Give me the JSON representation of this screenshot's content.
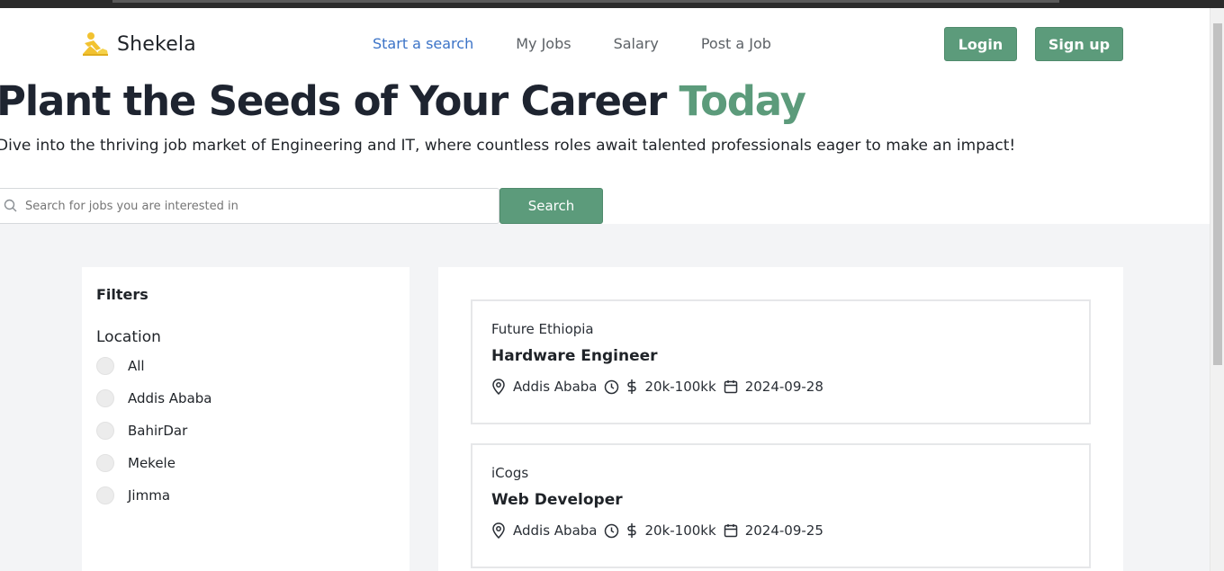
{
  "brand": {
    "name": "Shekela",
    "accent_color": "#5c9b7b",
    "link_color": "#3b73c7"
  },
  "nav": {
    "links": [
      {
        "label": "Start a search",
        "active": true
      },
      {
        "label": "My Jobs",
        "active": false
      },
      {
        "label": "Salary",
        "active": false
      },
      {
        "label": "Post a Job",
        "active": false
      }
    ],
    "login_label": "Login",
    "signup_label": "Sign up"
  },
  "hero": {
    "title_main": "Plant the Seeds of Your Career ",
    "title_accent": "Today",
    "subtitle": "Dive into the thriving job market of Engineering and IT, where countless roles await talented professionals eager to make an impact!"
  },
  "search": {
    "placeholder": "Search for jobs you are interested in",
    "button_label": "Search"
  },
  "filters": {
    "title": "Filters",
    "location_title": "Location",
    "locations": [
      "All",
      "Addis Ababa",
      "BahirDar",
      "Mekele",
      "Jimma"
    ]
  },
  "jobs": [
    {
      "company": "Future Ethiopia",
      "title": "Hardware Engineer",
      "location": "Addis Ababa",
      "salary": "20k-100kk",
      "date": "2024-09-28"
    },
    {
      "company": "iCogs",
      "title": "Web Developer",
      "location": "Addis Ababa",
      "salary": "20k-100kk",
      "date": "2024-09-25"
    }
  ]
}
